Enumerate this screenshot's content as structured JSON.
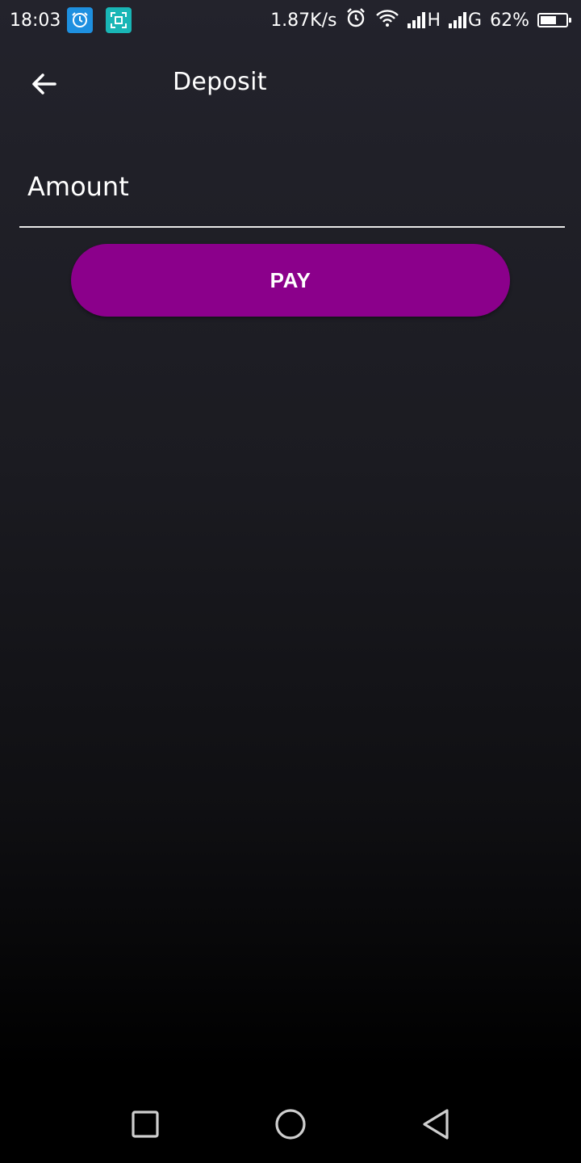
{
  "status_bar": {
    "time": "18:03",
    "network_speed": "1.87K/s",
    "network_1": "H",
    "network_2": "G",
    "battery_percent": "62%",
    "battery_level": 0.62,
    "icons": [
      "clock-app-icon",
      "screenshot-app-icon",
      "alarm-icon",
      "wifi-icon",
      "signal-icon",
      "signal-icon",
      "battery-icon"
    ]
  },
  "header": {
    "title": "Deposit",
    "back_icon": "arrow-left-icon"
  },
  "form": {
    "amount_placeholder": "Amount",
    "amount_value": "",
    "pay_label": "PAY"
  },
  "colors": {
    "accent": "#8b008b",
    "background_top": "#23232c",
    "background_bottom": "#000000"
  },
  "nav_bar": {
    "icons": [
      "recents-square-icon",
      "home-circle-icon",
      "back-triangle-icon"
    ]
  }
}
